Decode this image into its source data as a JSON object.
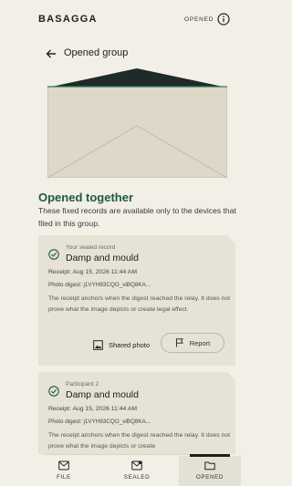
{
  "app": {
    "brand": "BASAGGA",
    "status": "OPENED"
  },
  "header": {
    "title": "Opened group"
  },
  "intro": {
    "heading": "Opened together",
    "body": "These fixed records are available only to the devices that filed in this group."
  },
  "records": [
    {
      "overline": "Your sealed record",
      "title": "Damp and mould",
      "receipt": "Receipt: Aug 15, 2026 11:44 AM",
      "digest": "Photo digest: j1VYH83CQO_viBQ8KA...",
      "note": "The receipt anchors when the digest reached the relay. It does not prove what the image depicts or create legal effect.",
      "shared_label": "Shared photo",
      "report_label": "Report"
    },
    {
      "overline": "Participant 2",
      "title": "Damp and mould",
      "receipt": "Receipt: Aug 15, 2026 11:44 AM",
      "digest": "Photo digest: j1VYH83CQO_viBQ8KA...",
      "note": "The receipt anchors when the digest reached the relay. It does not prove what the image depicts or create"
    }
  ],
  "nav": [
    {
      "label": "FILE",
      "icon": "envelope-icon"
    },
    {
      "label": "SEALED",
      "icon": "sealed-envelope-icon"
    },
    {
      "label": "OPENED",
      "icon": "folder-icon",
      "selected": true
    }
  ],
  "colors": {
    "background": "#f2efe6",
    "accent": "#1d5a44",
    "card": "#e6e2d5",
    "envelope_flap": "#1f2a2a"
  }
}
